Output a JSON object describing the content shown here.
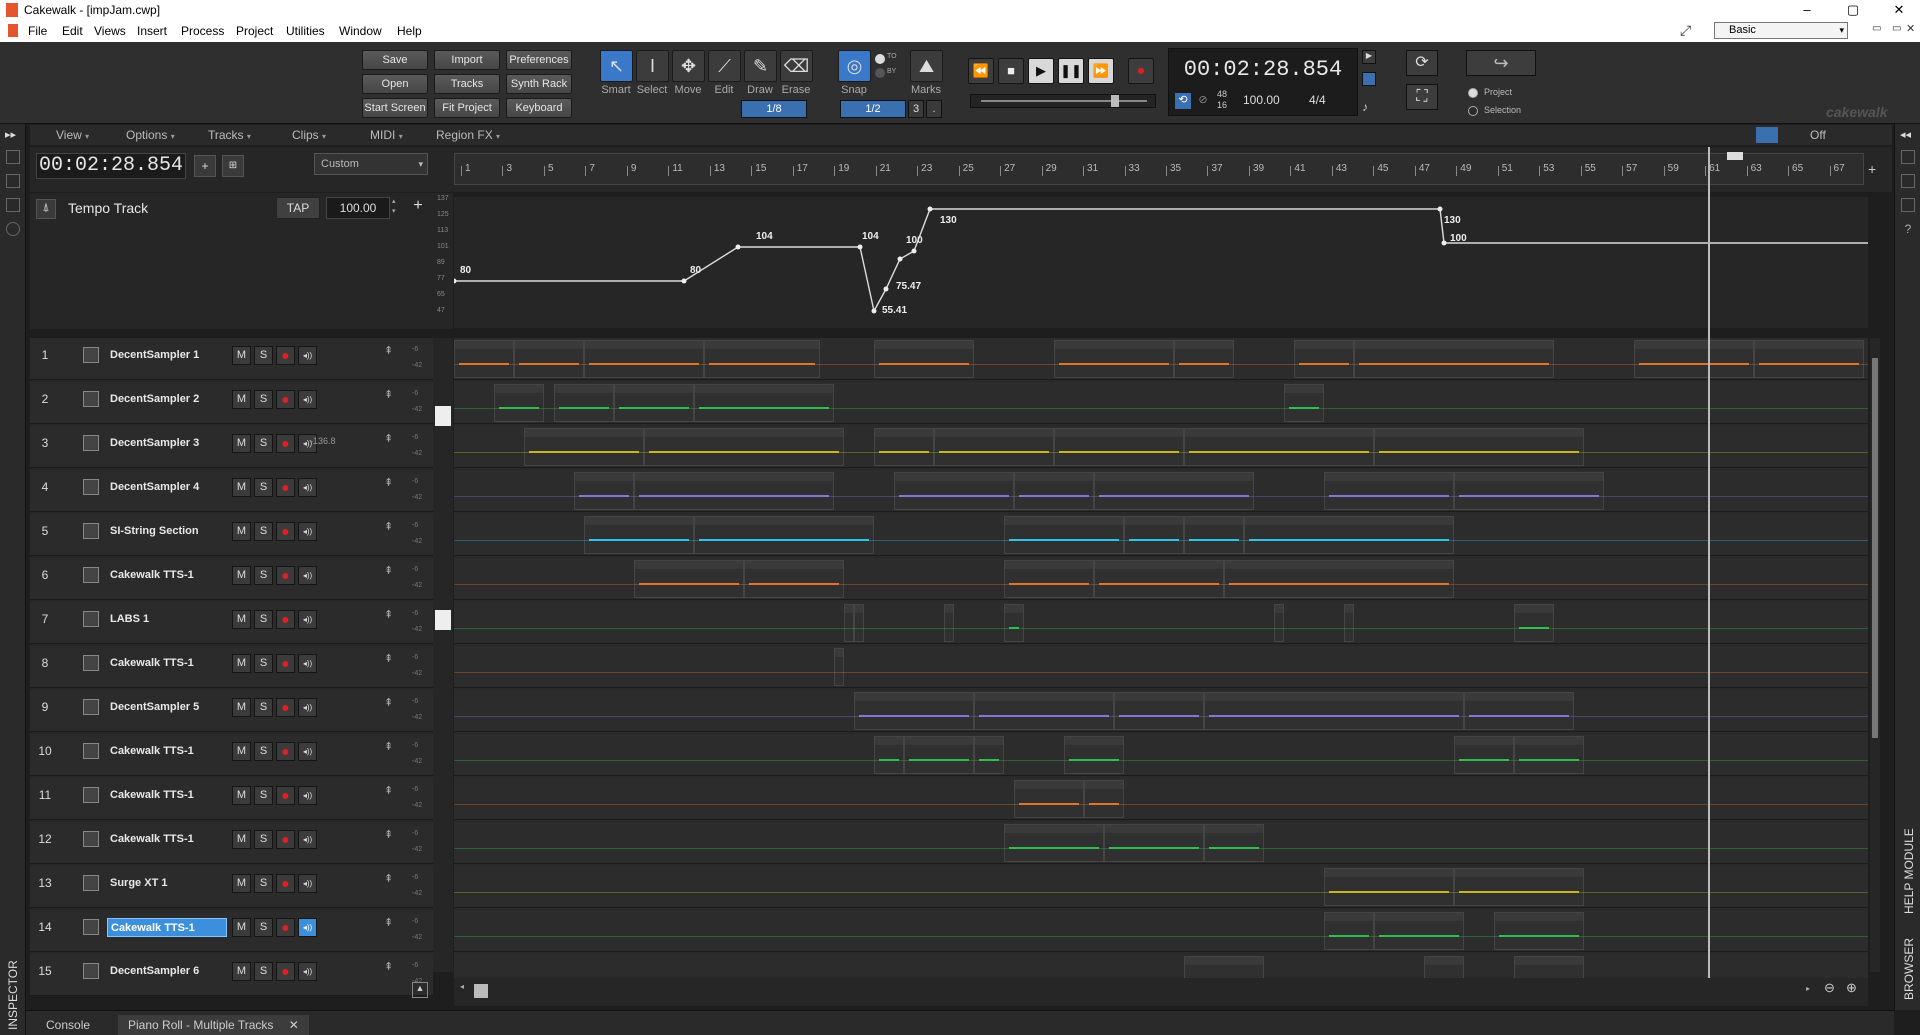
{
  "window": {
    "title": "Cakewalk - [impJam.cwp]",
    "minimize": "–",
    "restore": "▢",
    "close": "✕"
  },
  "menu": [
    "File",
    "Edit",
    "Views",
    "Insert",
    "Process",
    "Project",
    "Utilities",
    "Window",
    "Help"
  ],
  "control_bar": {
    "buttons": {
      "save": "Save",
      "import": "Import",
      "preferences": "Preferences",
      "open": "Open",
      "tracks": "Tracks",
      "synth_rack": "Synth Rack",
      "start_screen": "Start Screen",
      "fit_project": "Fit Project",
      "keyboard": "Keyboard"
    },
    "tools": [
      {
        "label": "Smart",
        "icon": "pointer-icon",
        "glyph": "↖",
        "active": true
      },
      {
        "label": "Select",
        "icon": "text-cursor-icon",
        "glyph": "I",
        "active": false
      },
      {
        "label": "Move",
        "icon": "move-icon",
        "glyph": "✥",
        "active": false
      },
      {
        "label": "Edit",
        "icon": "edit-icon",
        "glyph": "⟋",
        "active": false
      },
      {
        "label": "Draw",
        "icon": "pencil-icon",
        "glyph": "✎",
        "active": false
      },
      {
        "label": "Erase",
        "icon": "eraser-icon",
        "glyph": "⌫",
        "active": false
      }
    ],
    "snap_value": "1/8",
    "snap_label": "Snap",
    "snap_to": "TO",
    "snap_by": "BY",
    "marks_label": "Marks",
    "snap_res": "1/2",
    "snap_num": "3",
    "snap_dot": ".",
    "time": "00:02:28.854",
    "meter_top": "48",
    "meter_bottom": "16",
    "tempo": "100.00",
    "timesig": "4/4",
    "loop_project": "Project",
    "loop_selection": "Selection",
    "workspace": "Basic",
    "brand": "cakewalk"
  },
  "trackview_menu": [
    "View",
    "Options",
    "Tracks",
    "Clips",
    "MIDI",
    "Region FX"
  ],
  "trackview_right": {
    "off": "Off"
  },
  "now_time": "00:02:28.854",
  "custom_preset": "Custom",
  "ruler_marks": [
    "1",
    "3",
    "5",
    "7",
    "9",
    "11",
    "13",
    "15",
    "17",
    "19",
    "21",
    "23",
    "25",
    "27",
    "29",
    "31",
    "33",
    "35",
    "37",
    "39",
    "41",
    "43",
    "45",
    "47",
    "49",
    "51",
    "53",
    "55",
    "57",
    "59",
    "61",
    "63",
    "65",
    "67"
  ],
  "tempo_track": {
    "name": "Tempo Track",
    "tap": "TAP",
    "value": "100.00",
    "axis": [
      "137",
      "125",
      "113",
      "101",
      "89",
      "77",
      "65",
      "47"
    ],
    "points_labels": [
      "80",
      "80",
      "104",
      "104",
      "55.41",
      "75.47",
      "100",
      "130",
      "130",
      "100"
    ]
  },
  "tracks": [
    {
      "num": "1",
      "name": "DecentSampler 1",
      "val": "",
      "selected": false
    },
    {
      "num": "2",
      "name": "DecentSampler 2",
      "val": "",
      "selected": false
    },
    {
      "num": "3",
      "name": "DecentSampler 3",
      "val": "-136.8",
      "selected": false
    },
    {
      "num": "4",
      "name": "DecentSampler 4",
      "val": "",
      "selected": false
    },
    {
      "num": "5",
      "name": "SI-String Section",
      "val": "",
      "selected": false
    },
    {
      "num": "6",
      "name": "Cakewalk TTS-1",
      "val": "",
      "selected": false
    },
    {
      "num": "7",
      "name": "LABS 1",
      "val": "",
      "selected": false
    },
    {
      "num": "8",
      "name": "Cakewalk TTS-1",
      "val": "",
      "selected": false
    },
    {
      "num": "9",
      "name": "DecentSampler 5",
      "val": "",
      "selected": false
    },
    {
      "num": "10",
      "name": "Cakewalk TTS-1",
      "val": "",
      "selected": false
    },
    {
      "num": "11",
      "name": "Cakewalk TTS-1",
      "val": "",
      "selected": false
    },
    {
      "num": "12",
      "name": "Cakewalk TTS-1",
      "val": "",
      "selected": false
    },
    {
      "num": "13",
      "name": "Surge XT 1",
      "val": "",
      "selected": false
    },
    {
      "num": "14",
      "name": "Cakewalk TTS-1",
      "val": "",
      "selected": true
    },
    {
      "num": "15",
      "name": "DecentSampler 6",
      "val": "",
      "selected": false
    }
  ],
  "track_buttons": {
    "mute": "M",
    "solo": "S",
    "record": "●",
    "echo": "◂))"
  },
  "meter_labels": {
    "top": "-6",
    "bottom": "-42"
  },
  "bottom_tabs": {
    "console": "Console",
    "piano_roll": "Piano Roll - Multiple Tracks",
    "close": "✕"
  },
  "side_labels": {
    "inspector": "INSPECTOR",
    "browser": "BROWSER",
    "help": "HELP MODULE"
  },
  "colors": {
    "accent": "#3c8fdb",
    "tempo_line": "#dddddd",
    "clip_orange": "#e0742a",
    "clip_green": "#2fbf4f",
    "clip_yellow": "#c9b51f",
    "clip_cyan": "#2fc3e8",
    "clip_purple": "#8a73d6"
  }
}
